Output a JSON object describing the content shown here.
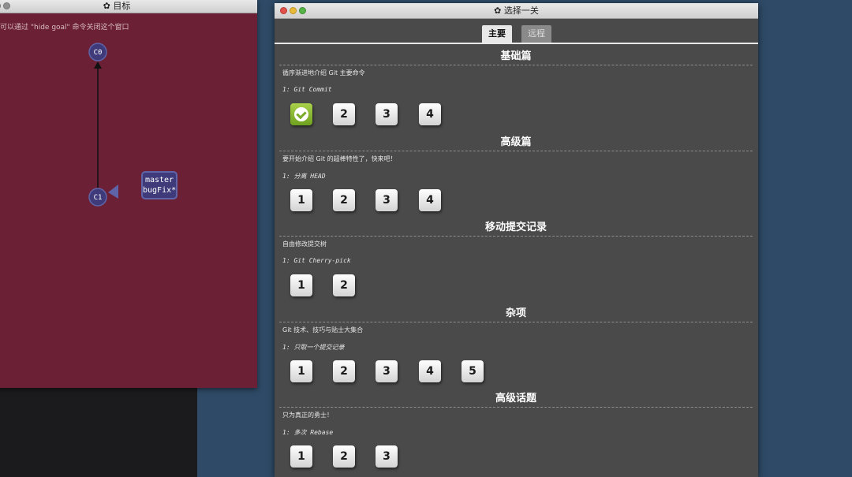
{
  "goal_window": {
    "title": "目标",
    "title_icon": "gear-icon",
    "hint": "可以通过 \"hide goal\" 命令关闭这个窗口",
    "nodes": [
      "C0",
      "C1"
    ],
    "branch_labels": [
      "master",
      "bugFix*"
    ]
  },
  "level_window": {
    "title": "选择一关",
    "title_icon": "gear-icon",
    "tabs": [
      {
        "label": "主要",
        "active": true
      },
      {
        "label": "远程",
        "active": false
      }
    ],
    "sections": [
      {
        "title": "基础篇",
        "desc": "循序渐进地介绍 Git 主要命令",
        "sub": "1: Git Commit",
        "levels": [
          "",
          "2",
          "3",
          "4"
        ],
        "completed": [
          0
        ]
      },
      {
        "title": "高级篇",
        "desc": "要开始介绍 Git 的超棒特性了，快来吧！",
        "sub": "1: 分离 HEAD",
        "levels": [
          "1",
          "2",
          "3",
          "4"
        ],
        "completed": []
      },
      {
        "title": "移动提交记录",
        "desc": "自由修改提交树",
        "sub": "1: Git Cherry-pick",
        "levels": [
          "1",
          "2"
        ],
        "completed": []
      },
      {
        "title": "杂项",
        "desc": "Git 技术、技巧与贴士大集合",
        "sub": "1: 只取一个提交记录",
        "levels": [
          "1",
          "2",
          "3",
          "4",
          "5"
        ],
        "completed": []
      },
      {
        "title": "高级话题",
        "desc": "只为真正的勇士！",
        "sub": "1: 多次 Rebase",
        "levels": [
          "1",
          "2",
          "3"
        ],
        "completed": []
      }
    ]
  },
  "colors": {
    "goal_bg": "#6b2035",
    "node_fill": "#3f3a7a",
    "panel_bg": "#4a4a4a",
    "desktop": "#2e4a66",
    "check_green": "#7bab2a"
  }
}
